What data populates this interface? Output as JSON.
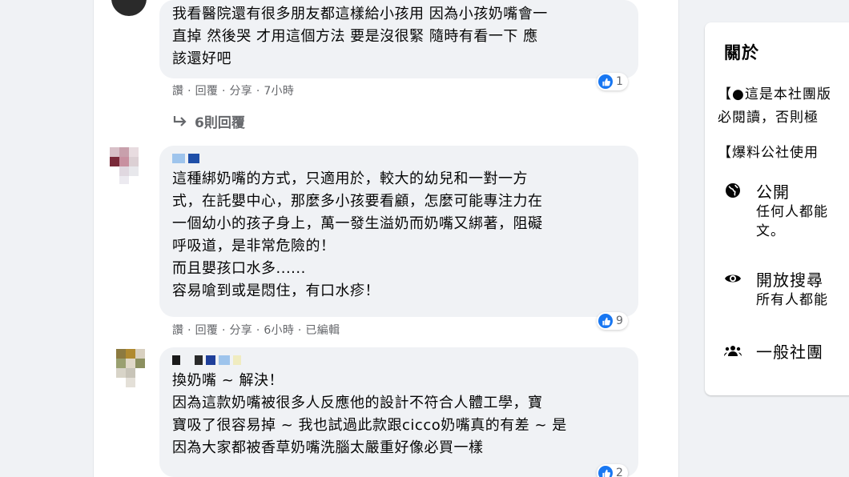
{
  "comments": [
    {
      "lines": [
        "我看醫院還有很多朋友都這樣給小孩用 因為小孩奶嘴會一",
        "直掉 然後哭 才用這個方法 要是沒很緊 隨時有看一下 應",
        "該還好吧"
      ],
      "actions": {
        "like": "讚",
        "reply": "回覆",
        "share": "分享",
        "time": "7小時"
      },
      "reaction_count": "1",
      "replies_label": "6則回覆"
    },
    {
      "lines": [
        "這種綁奶嘴的方式，只適用於，較大的幼兒和一對一方",
        "式，在託嬰中心，那麼多小孩要看顧，怎麼可能專注力在",
        "一個幼小的孩子身上，萬一發生溢奶而奶嘴又綁著，阻礙",
        "呼吸道，是非常危險的！",
        "而且嬰孩口水多......",
        "容易嗆到或是悶住，有口水疹！"
      ],
      "actions": {
        "like": "讚",
        "reply": "回覆",
        "share": "分享",
        "time": "6小時",
        "edited": "已編輯"
      },
      "reaction_count": "9"
    },
    {
      "lines": [
        "換奶嘴 ~ 解決！",
        "因為這款奶嘴被很多人反應他的設計不符合人體工學，寶",
        "寶吸了很容易掉 ~ 我也試過此款跟cicco奶嘴真的有差 ~ 是",
        "因為大家都被香草奶嘴洗腦太嚴重好像必買一樣"
      ],
      "reaction_count": "2"
    }
  ],
  "about": {
    "title": "關於",
    "desc_line1": "【●這是本社團版",
    "desc_line2": "必閱讀，否則極",
    "desc_line3": "【爆料公社使用",
    "public_label": "公開",
    "public_sub1": "任何人都能",
    "public_sub2": "文。",
    "search_label": "開放搜尋",
    "search_sub": "所有人都能",
    "group_label": "一般社團"
  },
  "colors": {
    "accent": "#1877f2",
    "muted": "#65676b",
    "bubble": "#f0f2f5"
  }
}
